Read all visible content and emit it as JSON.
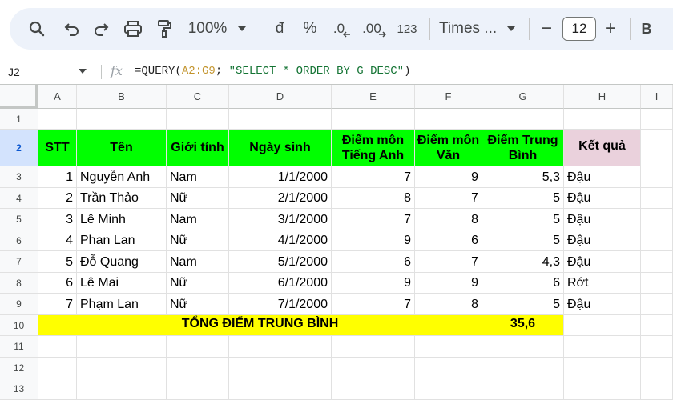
{
  "toolbar": {
    "zoom": "100%",
    "currency_label": "đ",
    "percent_label": "%",
    "decrease_decimal_label": ".0",
    "increase_decimal_label": ".00",
    "format_123_label": "123",
    "font_name": "Times ...",
    "font_size": "12",
    "bold_label": "B",
    "minus_label": "−",
    "plus_label": "+"
  },
  "formula_bar": {
    "name_box": "J2",
    "fx": "fx",
    "formula_prefix": "=QUERY(",
    "formula_range": "A2:G9",
    "formula_sep": "; ",
    "formula_string": "\"SELECT * ORDER BY G DESC\"",
    "formula_suffix": ")"
  },
  "columns": [
    "A",
    "B",
    "C",
    "D",
    "E",
    "F",
    "G",
    "H",
    "I"
  ],
  "rows": [
    "1",
    "2",
    "3",
    "4",
    "5",
    "6",
    "7",
    "8",
    "9",
    "10",
    "11",
    "12",
    "13"
  ],
  "header": {
    "stt": "STT",
    "ten": "Tên",
    "gioi_tinh": "Giới tính",
    "ngay_sinh": "Ngày sinh",
    "diem_anh": "Điểm môn Tiếng Anh",
    "diem_van": "Điểm môn Văn",
    "diem_tb": "Điểm Trung Bình",
    "ket_qua": "Kết quả"
  },
  "data_rows": [
    {
      "stt": "1",
      "ten": "Nguyễn Anh",
      "gioi_tinh": "Nam",
      "ngay_sinh": "1/1/2000",
      "anh": "7",
      "van": "9",
      "tb": "5,3",
      "kq": "Đậu"
    },
    {
      "stt": "2",
      "ten": "Trần Thảo",
      "gioi_tinh": "Nữ",
      "ngay_sinh": "2/1/2000",
      "anh": "8",
      "van": "7",
      "tb": "5",
      "kq": "Đậu"
    },
    {
      "stt": "3",
      "ten": "Lê Minh",
      "gioi_tinh": "Nam",
      "ngay_sinh": "3/1/2000",
      "anh": "7",
      "van": "8",
      "tb": "5",
      "kq": "Đậu"
    },
    {
      "stt": "4",
      "ten": "Phan Lan",
      "gioi_tinh": "Nữ",
      "ngay_sinh": "4/1/2000",
      "anh": "9",
      "van": "6",
      "tb": "5",
      "kq": "Đậu"
    },
    {
      "stt": "5",
      "ten": "Đỗ Quang",
      "gioi_tinh": "Nam",
      "ngay_sinh": "5/1/2000",
      "anh": "6",
      "van": "7",
      "tb": "4,3",
      "kq": "Đậu"
    },
    {
      "stt": "6",
      "ten": "Lê Mai",
      "gioi_tinh": "Nữ",
      "ngay_sinh": "6/1/2000",
      "anh": "9",
      "van": "9",
      "tb": "6",
      "kq": "Rớt"
    },
    {
      "stt": "7",
      "ten": "Phạm Lan",
      "gioi_tinh": "Nữ",
      "ngay_sinh": "7/1/2000",
      "anh": "7",
      "van": "8",
      "tb": "5",
      "kq": "Đậu"
    }
  ],
  "total": {
    "label": "TỔNG ĐIỂM TRUNG BÌNH",
    "value": "35,6"
  },
  "colors": {
    "header_green": "#00ff00",
    "result_header_pink": "#ead1dc",
    "total_yellow": "#ffff00",
    "selection_blue": "#1a73e8"
  }
}
